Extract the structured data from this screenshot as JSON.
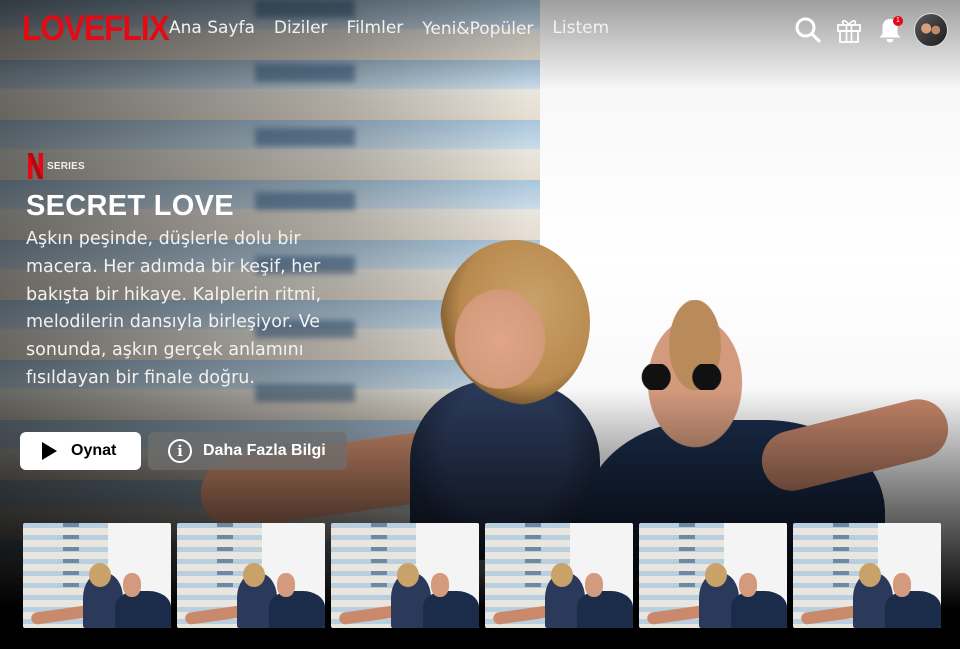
{
  "brand": {
    "name": "LOVEFLIX",
    "color": "#e50914"
  },
  "nav": {
    "items": [
      {
        "label": "Ana Sayfa"
      },
      {
        "label": "Diziler"
      },
      {
        "label": "Filmler"
      },
      {
        "label": "Yeni&Popüler"
      },
      {
        "label": "Listem"
      }
    ]
  },
  "header_icons": {
    "search": "search-icon",
    "gift": "gift-icon",
    "notifications": "bell-icon",
    "notification_count": "1",
    "profile": "avatar"
  },
  "featured": {
    "badge_logo": "N",
    "badge_label": "SERIES",
    "title": "SECRET LOVE",
    "description": "Aşkın peşinde, düşlerle dolu bir macera. Her adımda bir keşif, her bakışta bir hikaye. Kalplerin ritmi, melodilerin dansıyla birleşiyor. Ve sonunda, aşkın gerçek anlamını fısıldayan bir finale doğru.",
    "play_label": "Oynat",
    "info_label": "Daha Fazla Bilgi"
  },
  "row": {
    "thumbnails": [
      {
        "image": "thumbnail-secret-love"
      },
      {
        "image": "thumbnail-secret-love"
      },
      {
        "image": "thumbnail-secret-love"
      },
      {
        "image": "thumbnail-secret-love"
      },
      {
        "image": "thumbnail-secret-love"
      },
      {
        "image": "thumbnail-secret-love"
      }
    ]
  }
}
